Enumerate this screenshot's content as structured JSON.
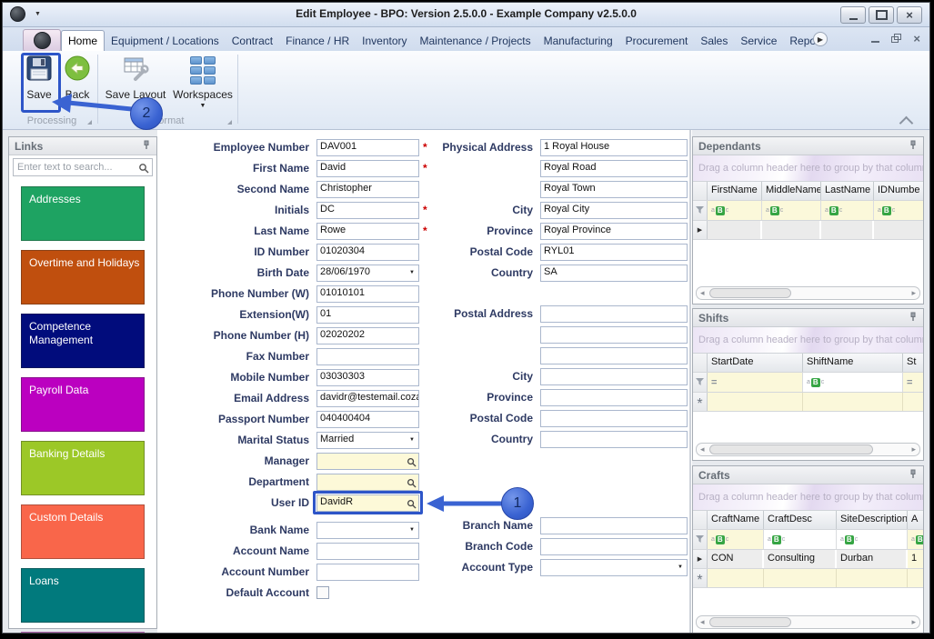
{
  "window": {
    "title": "Edit Employee - BPO: Version 2.5.0.0 - Example Company v2.5.0.0"
  },
  "ribbon": {
    "tabs": [
      "Home",
      "Equipment / Locations",
      "Contract",
      "Finance / HR",
      "Inventory",
      "Maintenance / Projects",
      "Manufacturing",
      "Procurement",
      "Sales",
      "Service",
      "Reports"
    ],
    "buttons": {
      "save": "Save",
      "back": "Back",
      "save_layout": "Save Layout",
      "workspaces": "Workspaces"
    },
    "groups": {
      "processing": "Processing",
      "format": "Format"
    }
  },
  "links": {
    "title": "Links",
    "search_placeholder": "Enter text to search...",
    "tiles": [
      {
        "label": "Addresses",
        "color": "#1ea362"
      },
      {
        "label": "Overtime and Holidays",
        "color": "#c04f0e"
      },
      {
        "label": "Competence Management",
        "color": "#010c7c"
      },
      {
        "label": "Payroll Data",
        "color": "#bb00c0"
      },
      {
        "label": "Banking Details",
        "color": "#9cc827"
      },
      {
        "label": "Custom Details",
        "color": "#f9664a"
      },
      {
        "label": "Loans",
        "color": "#017a7d"
      },
      {
        "label": "",
        "color": "#f27bef"
      }
    ]
  },
  "form": {
    "left": [
      {
        "label": "Employee Number",
        "value": "DAV001",
        "type": "text",
        "required": true
      },
      {
        "label": "First Name",
        "value": "David",
        "type": "text",
        "required": true
      },
      {
        "label": "Second Name",
        "value": "Christopher",
        "type": "text"
      },
      {
        "label": "Initials",
        "value": "DC",
        "type": "text",
        "required": true
      },
      {
        "label": "Last Name",
        "value": "Rowe",
        "type": "text",
        "required": true
      },
      {
        "label": "ID Number",
        "value": "01020304",
        "type": "text"
      },
      {
        "label": "Birth Date",
        "value": "28/06/1970",
        "type": "combo"
      },
      {
        "label": "Phone Number (W)",
        "value": "01010101",
        "type": "text"
      },
      {
        "label": "Extension(W)",
        "value": "01",
        "type": "text"
      },
      {
        "label": "Phone Number (H)",
        "value": "02020202",
        "type": "text"
      },
      {
        "label": "Fax Number",
        "value": "",
        "type": "text"
      },
      {
        "label": "Mobile Number",
        "value": "03030303",
        "type": "text"
      },
      {
        "label": "Email Address",
        "value": "davidr@testemail.coza",
        "type": "text"
      },
      {
        "label": "Passport Number",
        "value": "040400404",
        "type": "text"
      },
      {
        "label": "Marital Status",
        "value": "Married",
        "type": "combo"
      },
      {
        "label": "Manager",
        "value": "",
        "type": "search"
      },
      {
        "label": "Department",
        "value": "",
        "type": "search"
      },
      {
        "label": "User ID",
        "value": "DavidR",
        "type": "search",
        "highlight": true
      },
      {
        "label": "Bank Name",
        "value": "",
        "type": "combo"
      },
      {
        "label": "Account Name",
        "value": "",
        "type": "text"
      },
      {
        "label": "Account Number",
        "value": "",
        "type": "text"
      },
      {
        "label": "Default Account",
        "value": "",
        "type": "check"
      }
    ],
    "right": [
      {
        "label": "Physical Address",
        "value": "1 Royal House",
        "type": "text"
      },
      {
        "label": "",
        "value": "Royal Road",
        "type": "text"
      },
      {
        "label": "",
        "value": "Royal Town",
        "type": "text"
      },
      {
        "label": "City",
        "value": "Royal City",
        "type": "text"
      },
      {
        "label": "Province",
        "value": "Royal Province",
        "type": "text"
      },
      {
        "label": "Postal Code",
        "value": "RYL01",
        "type": "text"
      },
      {
        "label": "Country",
        "value": "SA",
        "type": "text"
      },
      {
        "label": "Postal Address",
        "value": "",
        "type": "text"
      },
      {
        "label": "",
        "value": "",
        "type": "text"
      },
      {
        "label": "",
        "value": "",
        "type": "text"
      },
      {
        "label": "City",
        "value": "",
        "type": "text"
      },
      {
        "label": "Province",
        "value": "",
        "type": "text"
      },
      {
        "label": "Postal Code",
        "value": "",
        "type": "text"
      },
      {
        "label": "Country",
        "value": "",
        "type": "text"
      },
      {
        "label": "Branch Name",
        "value": "",
        "type": "text"
      },
      {
        "label": "Branch Code",
        "value": "",
        "type": "text"
      },
      {
        "label": "Account Type",
        "value": "",
        "type": "combo"
      }
    ]
  },
  "grids": {
    "hint": "Drag a column header here to group by that column",
    "dependants": {
      "title": "Dependants",
      "columns": [
        "FirstName",
        "MiddleName",
        "LastName",
        "IDNumbe"
      ],
      "filters": [
        {
          "kind": "abc"
        },
        {
          "kind": "abc"
        },
        {
          "kind": "abc"
        },
        {
          "kind": "abc"
        }
      ]
    },
    "shifts": {
      "title": "Shifts",
      "columns": [
        "StartDate",
        "ShiftName",
        "St"
      ],
      "filters": [
        {
          "kind": "eq"
        },
        {
          "kind": "abc"
        },
        {
          "kind": "eq"
        }
      ]
    },
    "crafts": {
      "title": "Crafts",
      "columns": [
        "CraftName",
        "CraftDesc",
        "SiteDescription",
        "A"
      ],
      "filters": [
        {
          "kind": "abc"
        },
        {
          "kind": "abc"
        },
        {
          "kind": "abc"
        },
        {
          "kind": "abc"
        }
      ],
      "rows": [
        {
          "cells": [
            "CON",
            "Consulting",
            "Durban",
            "1"
          ]
        }
      ]
    }
  },
  "callouts": {
    "step1": "1",
    "step2": "2"
  }
}
